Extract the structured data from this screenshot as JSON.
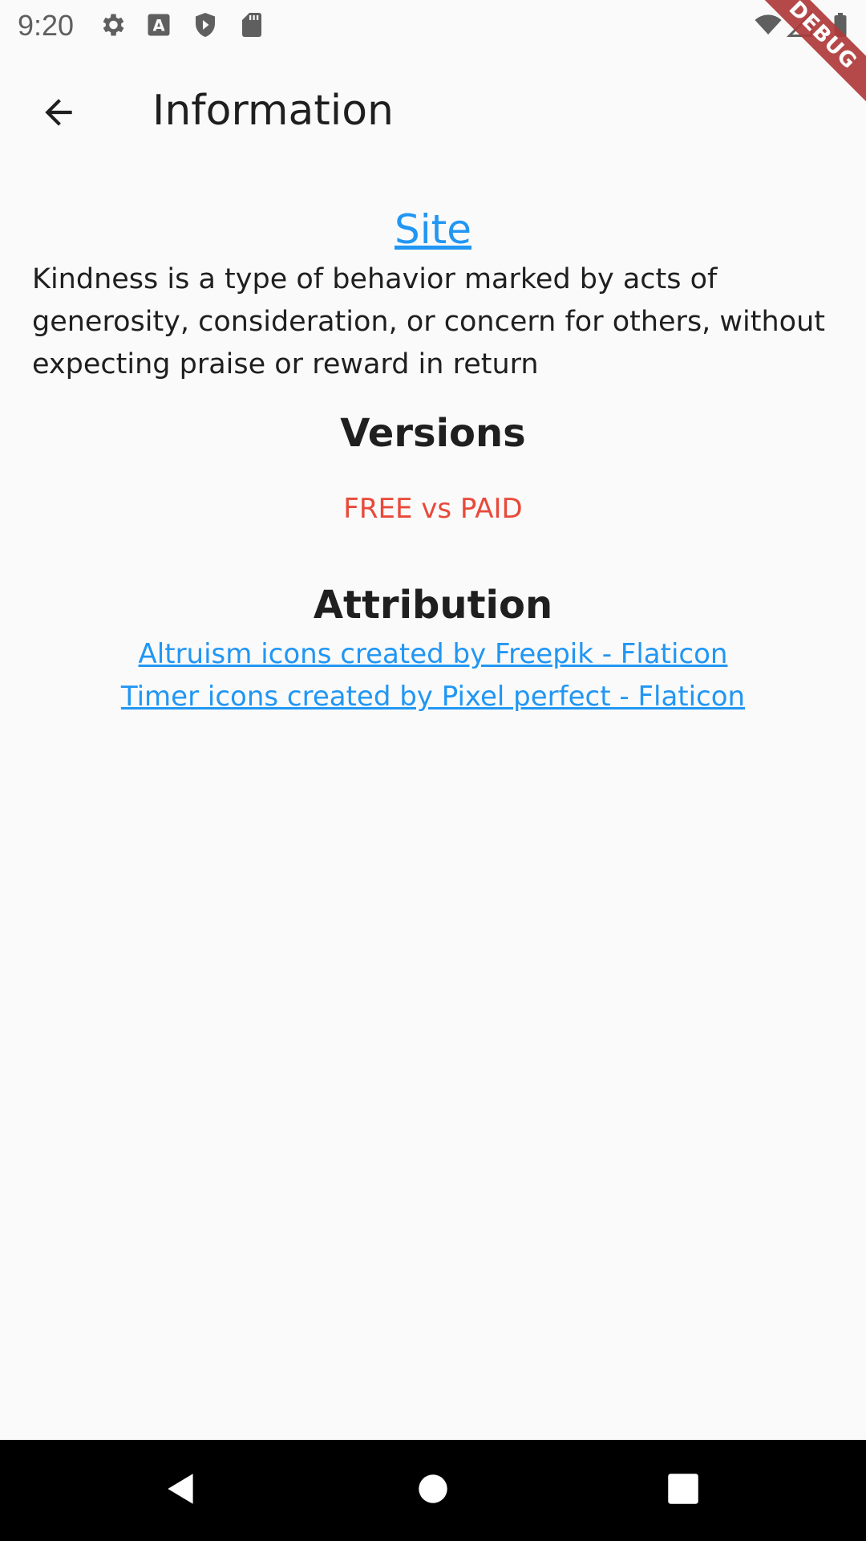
{
  "status_bar": {
    "time": "9:20",
    "icons": [
      "gear-icon",
      "a-icon",
      "shield-play-icon",
      "sd-card-icon",
      "wifi-icon",
      "signal-icon",
      "battery-icon"
    ]
  },
  "debug_banner": "DEBUG",
  "app_bar": {
    "title": "Information",
    "back_icon": "arrow-back-icon"
  },
  "content": {
    "site_link": "Site",
    "description": "Kindness is a type of behavior marked by acts of generosity, consideration, or concern for others, without expecting praise or reward in return",
    "versions_heading": "Versions",
    "versions_link": "FREE vs PAID",
    "attribution_heading": "Attribution",
    "attribution_links": [
      "Altruism icons created by Freepik - Flaticon",
      "Timer icons created by Pixel perfect - Flaticon"
    ]
  },
  "nav_bar": {
    "icons": [
      "back-triangle-icon",
      "home-circle-icon",
      "recents-square-icon"
    ]
  },
  "colors": {
    "link": "#2196f3",
    "accent_red": "#e8493a",
    "background": "#fafafa",
    "debug_ribbon": "#b03a3a"
  }
}
